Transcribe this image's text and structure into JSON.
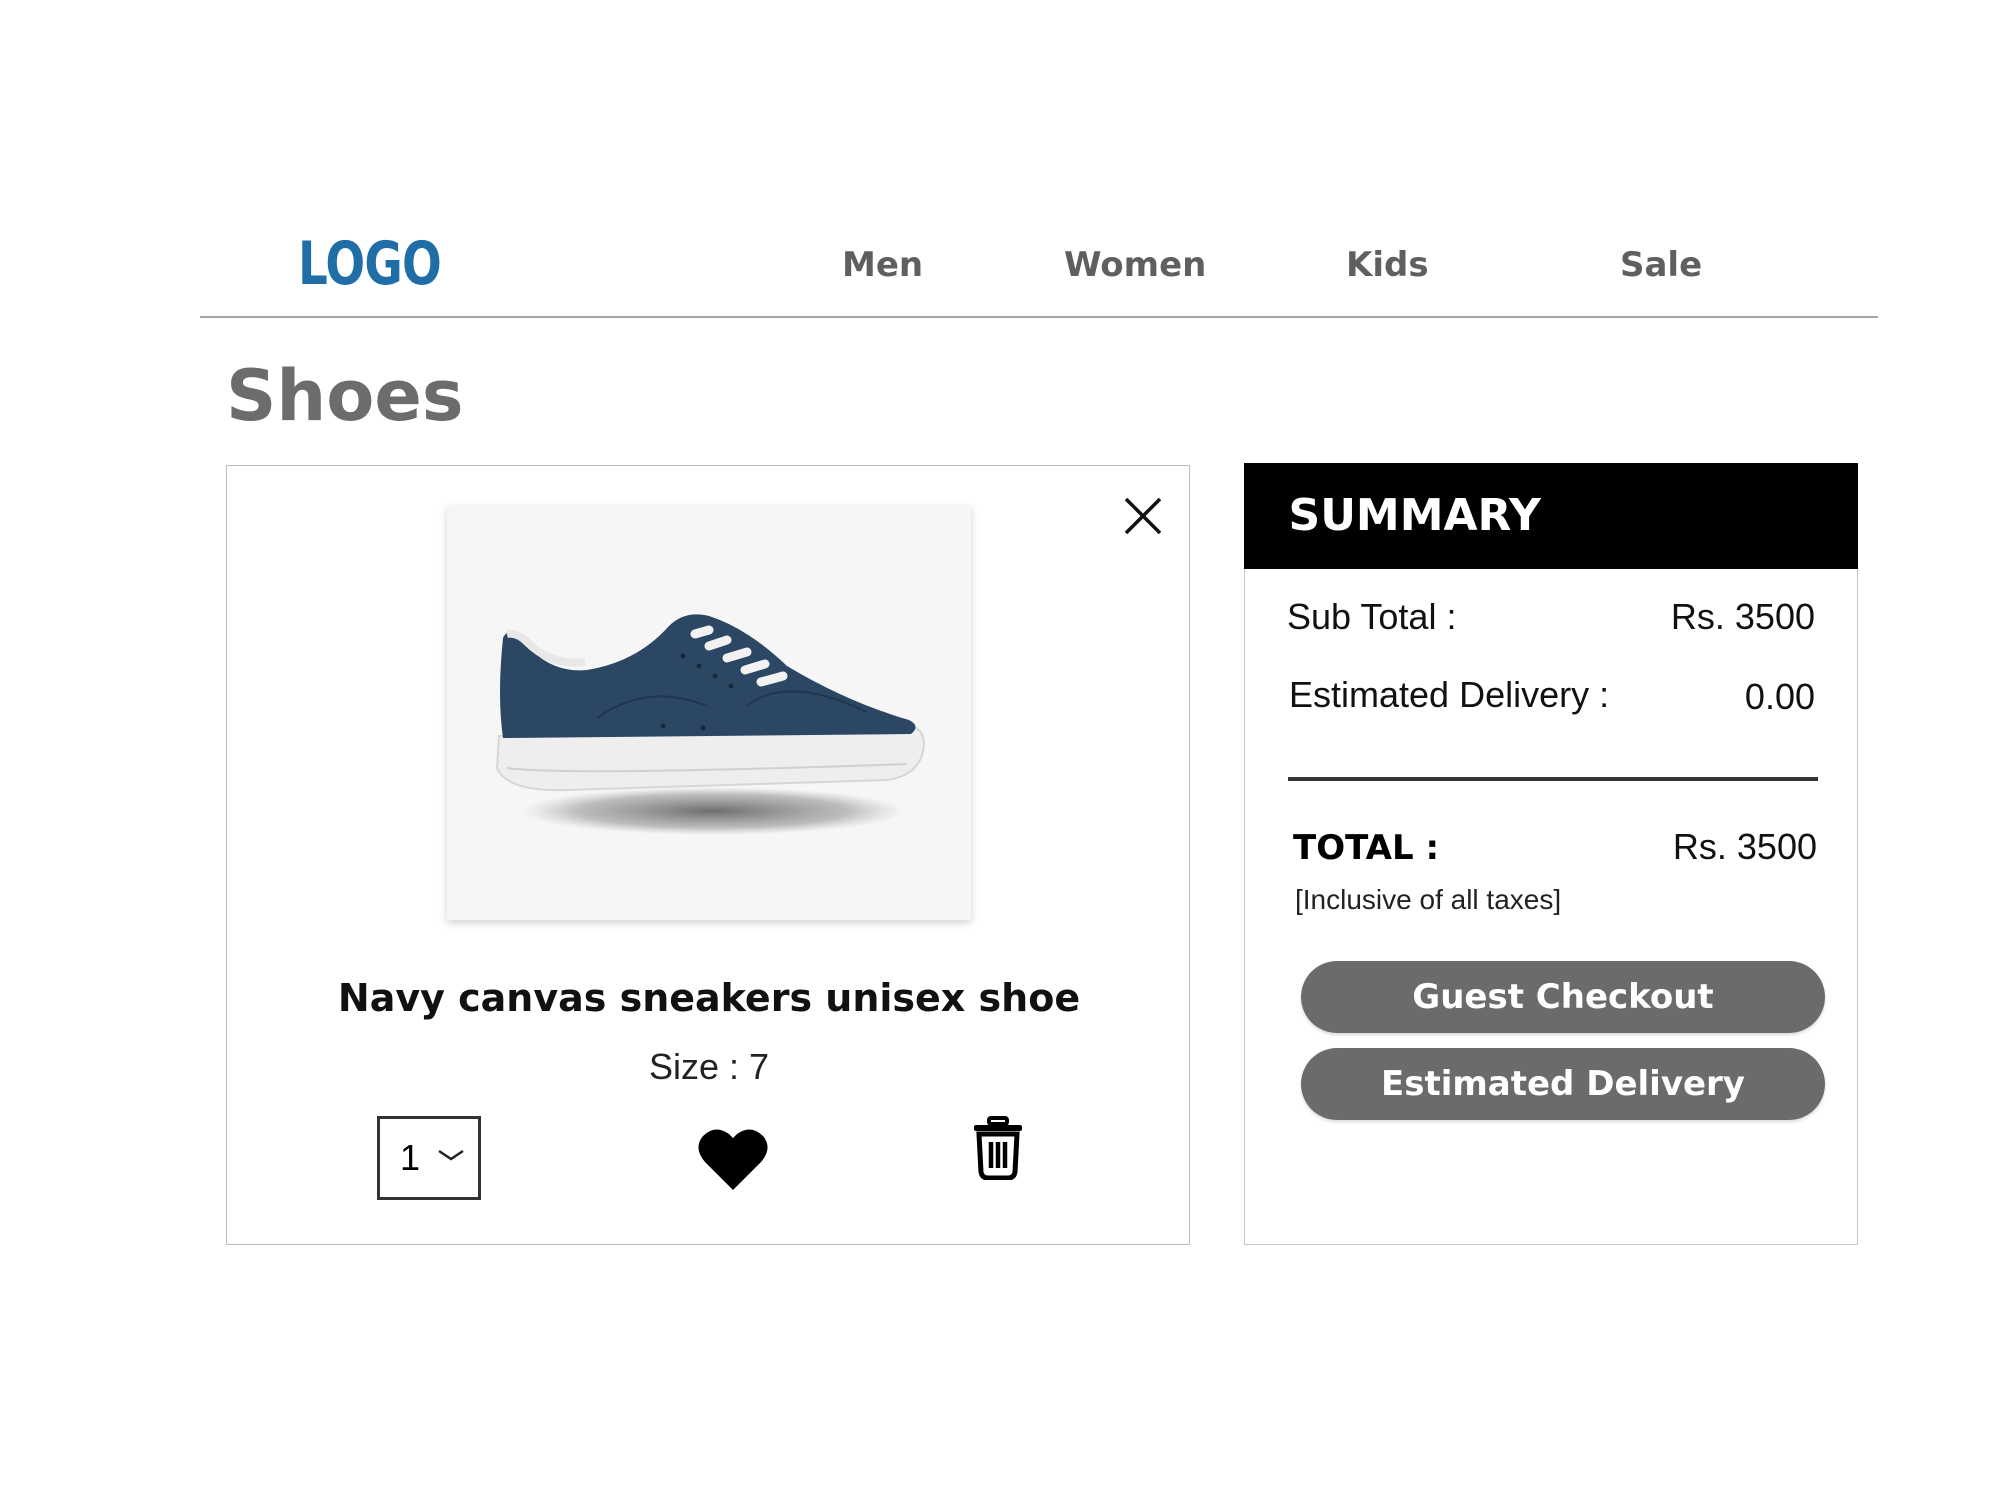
{
  "header": {
    "logo": "LOGO",
    "nav": [
      "Men",
      "Women",
      "Kids",
      "Sale"
    ]
  },
  "page": {
    "title": "Shoes"
  },
  "cart_item": {
    "name": "Navy canvas sneakers unisex shoe",
    "size": "Size : 7",
    "quantity": "1",
    "icons": {
      "close": "close-icon",
      "chevron": "chevron-down-icon",
      "wishlist": "heart-icon",
      "delete": "trash-icon"
    },
    "colors": {
      "shoe_upper": "#2b4763",
      "sole": "#eeeeee"
    }
  },
  "summary": {
    "title": "SUMMARY",
    "subtotal_label": "Sub Total :",
    "subtotal_value": "Rs. 3500",
    "delivery_label": "Estimated Delivery :",
    "delivery_value": "0.00",
    "total_label": "TOTAL :",
    "total_value": "Rs. 3500",
    "tax_note": "[Inclusive of all taxes]",
    "guest_checkout_label": "Guest Checkout",
    "estimated_delivery_label": "Estimated Delivery"
  },
  "colors": {
    "logo": "#1f6ea8",
    "button": "#6b6b6b",
    "header_band": "#000000"
  }
}
